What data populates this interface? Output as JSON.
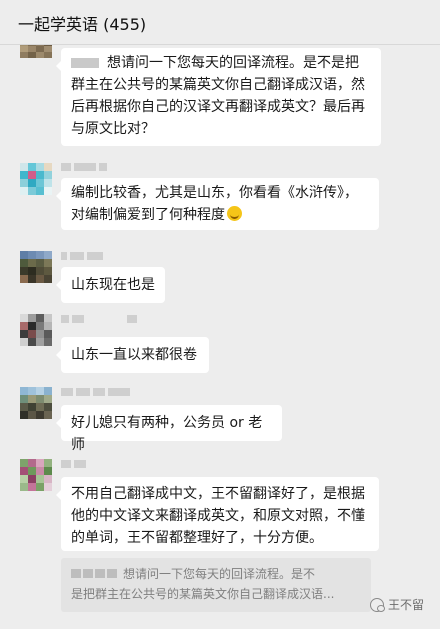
{
  "header": {
    "title": "一起学英语 (455)"
  },
  "messages": [
    {
      "text": "想请问一下您每天的回译流程。是不是把群主在公共号的某篇英文你自己翻译成汉语，然后再根据你自己的汉译文再翻译成英文？最后再与原文比对？"
    },
    {
      "text": "编制比较香，尤其是山东，你看看《水浒传》，对编制偏爱到了何种程度",
      "emoji": "grinning-sweat-emoji"
    },
    {
      "text": "山东现在也是"
    },
    {
      "text": "山东一直以来都很卷"
    },
    {
      "text": "好儿媳只有两种，公务员 or 老师"
    },
    {
      "text": "不用自己翻译成中文，王不留翻译好了，是根据他的中文译文来翻译成英文，和原文对照，不懂的单词，王不留都整理好了，十分方便。"
    }
  ],
  "quote": {
    "line1": "想请问一下您每天的回译流程。是不",
    "line2": "是把群主在公共号的某篇英文你自己翻译成汉语..."
  },
  "watermark": {
    "text": "王不留"
  },
  "colors": {
    "background": "#ededed",
    "bubble": "#ffffff",
    "quote_background": "#e3e3e3",
    "text": "#191919"
  }
}
